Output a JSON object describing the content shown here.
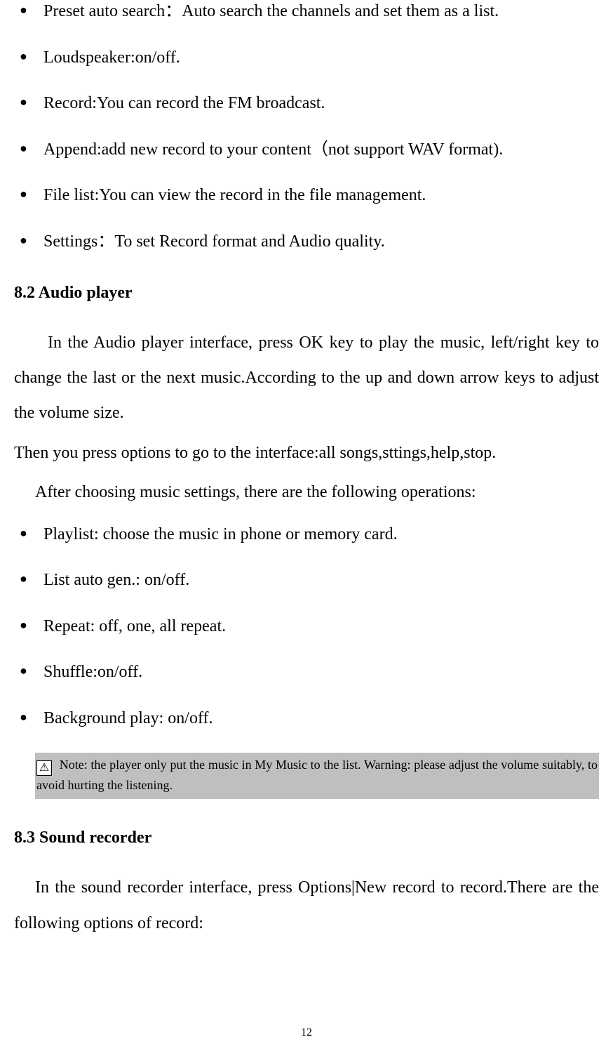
{
  "list1": {
    "items": [
      "Preset auto search：Auto search the channels and set them as a list.",
      "Loudspeaker:on/off.",
      "Record:You can record the FM broadcast.",
      "Append:add new record to your content（not support WAV format).",
      "File list:You can view the record in the file management.",
      "Settings：To set Record format and Audio quality."
    ]
  },
  "section_audio": {
    "heading": "8.2 Audio player",
    "para1": "In the Audio player interface, press OK key to play the music, left/right key to change the last or the next music.According to the up and down arrow keys to adjust the volume size.",
    "para2": "Then you press options to go to the interface:all songs,sttings,help,stop.",
    "operations_line": "After choosing music settings, there are the following operations:",
    "items": [
      "Playlist: choose the music in phone or memory card.",
      "List auto gen.: on/off.",
      "Repeat: off, one, all repeat.",
      "Shuffle:on/off.",
      "Background play: on/off."
    ],
    "note_icon_glyph": "⚠",
    "note_text": " Note: the player only put the music in My Music to the list. Warning: please adjust the volume suitably, to avoid hurting the listening."
  },
  "section_sound": {
    "heading": "8.3 Sound recorder",
    "para1": "In the sound recorder interface, press Options|New record to record.There are the following options of record:"
  },
  "page_number": "12"
}
